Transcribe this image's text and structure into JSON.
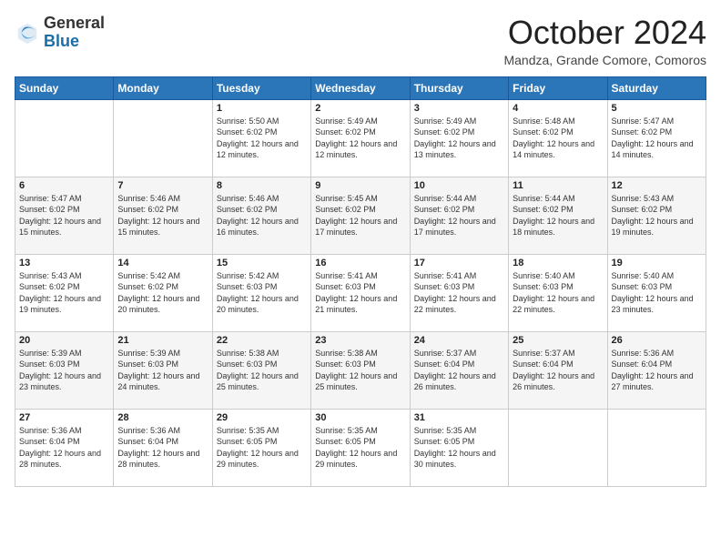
{
  "logo": {
    "general": "General",
    "blue": "Blue"
  },
  "header": {
    "month": "October 2024",
    "location": "Mandza, Grande Comore, Comoros"
  },
  "weekdays": [
    "Sunday",
    "Monday",
    "Tuesday",
    "Wednesday",
    "Thursday",
    "Friday",
    "Saturday"
  ],
  "weeks": [
    [
      {
        "day": "",
        "info": ""
      },
      {
        "day": "",
        "info": ""
      },
      {
        "day": "1",
        "info": "Sunrise: 5:50 AM\nSunset: 6:02 PM\nDaylight: 12 hours and 12 minutes."
      },
      {
        "day": "2",
        "info": "Sunrise: 5:49 AM\nSunset: 6:02 PM\nDaylight: 12 hours and 12 minutes."
      },
      {
        "day": "3",
        "info": "Sunrise: 5:49 AM\nSunset: 6:02 PM\nDaylight: 12 hours and 13 minutes."
      },
      {
        "day": "4",
        "info": "Sunrise: 5:48 AM\nSunset: 6:02 PM\nDaylight: 12 hours and 14 minutes."
      },
      {
        "day": "5",
        "info": "Sunrise: 5:47 AM\nSunset: 6:02 PM\nDaylight: 12 hours and 14 minutes."
      }
    ],
    [
      {
        "day": "6",
        "info": "Sunrise: 5:47 AM\nSunset: 6:02 PM\nDaylight: 12 hours and 15 minutes."
      },
      {
        "day": "7",
        "info": "Sunrise: 5:46 AM\nSunset: 6:02 PM\nDaylight: 12 hours and 15 minutes."
      },
      {
        "day": "8",
        "info": "Sunrise: 5:46 AM\nSunset: 6:02 PM\nDaylight: 12 hours and 16 minutes."
      },
      {
        "day": "9",
        "info": "Sunrise: 5:45 AM\nSunset: 6:02 PM\nDaylight: 12 hours and 17 minutes."
      },
      {
        "day": "10",
        "info": "Sunrise: 5:44 AM\nSunset: 6:02 PM\nDaylight: 12 hours and 17 minutes."
      },
      {
        "day": "11",
        "info": "Sunrise: 5:44 AM\nSunset: 6:02 PM\nDaylight: 12 hours and 18 minutes."
      },
      {
        "day": "12",
        "info": "Sunrise: 5:43 AM\nSunset: 6:02 PM\nDaylight: 12 hours and 19 minutes."
      }
    ],
    [
      {
        "day": "13",
        "info": "Sunrise: 5:43 AM\nSunset: 6:02 PM\nDaylight: 12 hours and 19 minutes."
      },
      {
        "day": "14",
        "info": "Sunrise: 5:42 AM\nSunset: 6:02 PM\nDaylight: 12 hours and 20 minutes."
      },
      {
        "day": "15",
        "info": "Sunrise: 5:42 AM\nSunset: 6:03 PM\nDaylight: 12 hours and 20 minutes."
      },
      {
        "day": "16",
        "info": "Sunrise: 5:41 AM\nSunset: 6:03 PM\nDaylight: 12 hours and 21 minutes."
      },
      {
        "day": "17",
        "info": "Sunrise: 5:41 AM\nSunset: 6:03 PM\nDaylight: 12 hours and 22 minutes."
      },
      {
        "day": "18",
        "info": "Sunrise: 5:40 AM\nSunset: 6:03 PM\nDaylight: 12 hours and 22 minutes."
      },
      {
        "day": "19",
        "info": "Sunrise: 5:40 AM\nSunset: 6:03 PM\nDaylight: 12 hours and 23 minutes."
      }
    ],
    [
      {
        "day": "20",
        "info": "Sunrise: 5:39 AM\nSunset: 6:03 PM\nDaylight: 12 hours and 23 minutes."
      },
      {
        "day": "21",
        "info": "Sunrise: 5:39 AM\nSunset: 6:03 PM\nDaylight: 12 hours and 24 minutes."
      },
      {
        "day": "22",
        "info": "Sunrise: 5:38 AM\nSunset: 6:03 PM\nDaylight: 12 hours and 25 minutes."
      },
      {
        "day": "23",
        "info": "Sunrise: 5:38 AM\nSunset: 6:03 PM\nDaylight: 12 hours and 25 minutes."
      },
      {
        "day": "24",
        "info": "Sunrise: 5:37 AM\nSunset: 6:04 PM\nDaylight: 12 hours and 26 minutes."
      },
      {
        "day": "25",
        "info": "Sunrise: 5:37 AM\nSunset: 6:04 PM\nDaylight: 12 hours and 26 minutes."
      },
      {
        "day": "26",
        "info": "Sunrise: 5:36 AM\nSunset: 6:04 PM\nDaylight: 12 hours and 27 minutes."
      }
    ],
    [
      {
        "day": "27",
        "info": "Sunrise: 5:36 AM\nSunset: 6:04 PM\nDaylight: 12 hours and 28 minutes."
      },
      {
        "day": "28",
        "info": "Sunrise: 5:36 AM\nSunset: 6:04 PM\nDaylight: 12 hours and 28 minutes."
      },
      {
        "day": "29",
        "info": "Sunrise: 5:35 AM\nSunset: 6:05 PM\nDaylight: 12 hours and 29 minutes."
      },
      {
        "day": "30",
        "info": "Sunrise: 5:35 AM\nSunset: 6:05 PM\nDaylight: 12 hours and 29 minutes."
      },
      {
        "day": "31",
        "info": "Sunrise: 5:35 AM\nSunset: 6:05 PM\nDaylight: 12 hours and 30 minutes."
      },
      {
        "day": "",
        "info": ""
      },
      {
        "day": "",
        "info": ""
      }
    ]
  ]
}
